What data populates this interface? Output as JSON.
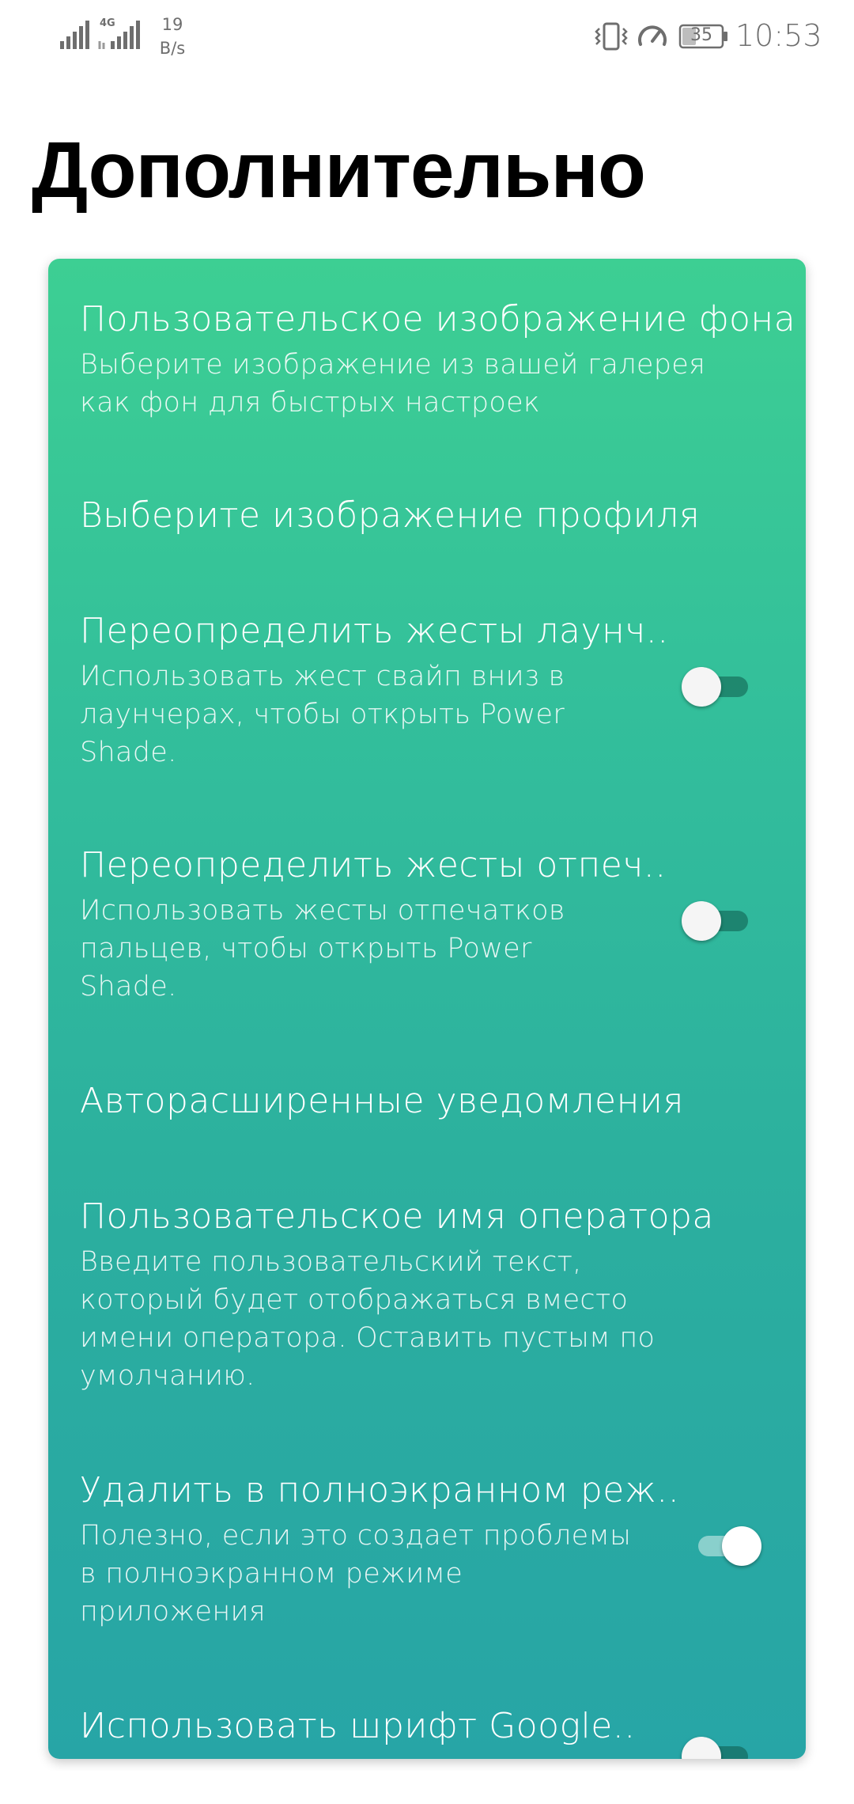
{
  "status_bar": {
    "network_type": "4G",
    "net_speed_value": "19",
    "net_speed_unit": "B/s",
    "battery_level": "35",
    "time": "10:53",
    "icons": [
      "signal-icon",
      "signal-4g-icon",
      "vibrate-icon",
      "data-saver-icon",
      "battery-icon"
    ]
  },
  "page": {
    "title": "Дополнительно"
  },
  "settings": [
    {
      "title": "Пользовательское изображение фона",
      "summary": "Выберите изображение из вашей галерея как фон для быстрых настроек"
    },
    {
      "title": "Выберите изображение профиля"
    },
    {
      "title": "Переопределить жесты лаунч..",
      "summary": "Использовать жест свайп вниз в лаунчерах, чтобы открыть Power Shade.",
      "toggle": "off"
    },
    {
      "title": "Переопределить жесты отпеч..",
      "summary": "Использовать жесты отпечатков пальцев, чтобы открыть Power Shade.",
      "toggle": "off"
    },
    {
      "title": "Авторасширенные уведомления"
    },
    {
      "title": "Пользовательское имя оператора",
      "summary": "Введите пользовательский текст, который будет отображаться вместо имени оператора. Оставить пустым по умолчанию."
    },
    {
      "title": "Удалить в полноэкранном реж..",
      "summary": "Полезно, если это создает проблемы в полноэкранном режиме приложения",
      "toggle": "on"
    },
    {
      "title": "Использовать шрифт Google..",
      "toggle": "off"
    }
  ],
  "colors": {
    "card_top": "#3dcf93",
    "card_bottom": "#27a5a6",
    "text_on_card": "#ffffff",
    "status_text": "#6e6e6e"
  }
}
